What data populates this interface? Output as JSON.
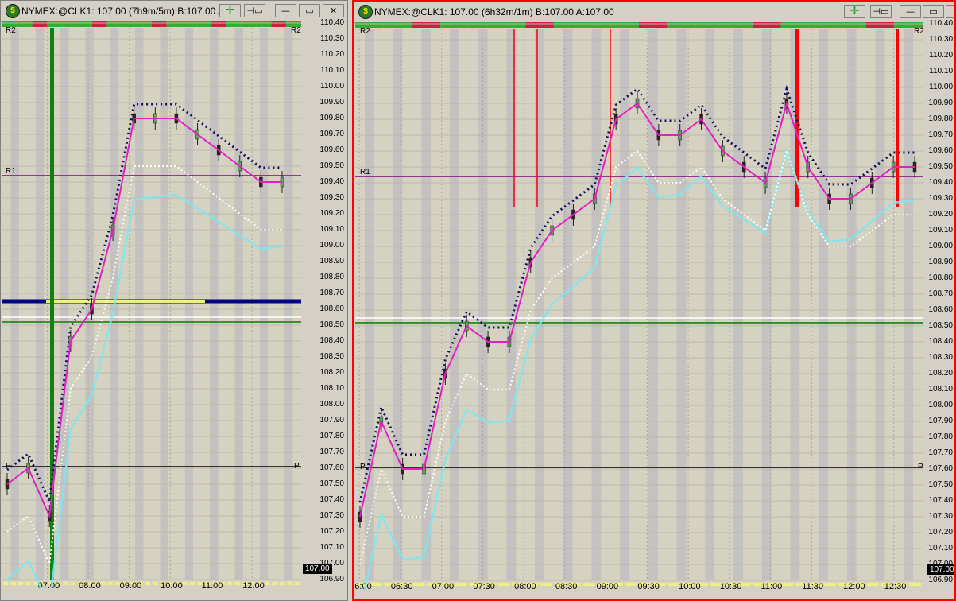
{
  "windows": [
    {
      "id": "left",
      "title": "NYMEX:@CLK1: 107.00 (7h9m/5m)   B:107.00 A:",
      "buttons": {
        "cursor": "✛",
        "pin": "⊣▭",
        "minimize": "—",
        "maximize": "▭",
        "close": "✕"
      },
      "price_labels": [
        "110.40",
        "110.30",
        "110.20",
        "110.10",
        "110.00",
        "109.90",
        "109.80",
        "109.70",
        "109.60",
        "109.50",
        "109.40",
        "109.30",
        "109.20",
        "109.10",
        "109.00",
        "108.90",
        "108.80",
        "108.70",
        "108.60",
        "108.50",
        "108.40",
        "108.30",
        "108.20",
        "108.10",
        "108.00",
        "107.90",
        "107.80",
        "107.70",
        "107.60",
        "107.50",
        "107.40",
        "107.30",
        "107.20",
        "107.10",
        "107.00",
        "106.90"
      ],
      "time_labels": [
        "07:00",
        "08:00",
        "09:00",
        "10:00",
        "11:00",
        "12:00"
      ],
      "last_price": "107.00",
      "level_labels": {
        "r2_left": "R2",
        "r2_right": "R2",
        "r1": "R1",
        "p_left": "P",
        "p_right": "P"
      }
    },
    {
      "id": "right",
      "title": "NYMEX:@CLK1: 107.00 (6h32m/1m)   B:107.00 A:107.00",
      "buttons": {
        "cursor": "✛",
        "pin": "⊣▭",
        "minimize": "—",
        "maximize": "▭",
        "close": "✕"
      },
      "price_labels": [
        "110.40",
        "110.30",
        "110.20",
        "110.10",
        "110.00",
        "109.90",
        "109.80",
        "109.70",
        "109.60",
        "109.50",
        "109.40",
        "109.30",
        "109.20",
        "109.10",
        "109.00",
        "108.90",
        "108.80",
        "108.70",
        "108.60",
        "108.50",
        "108.40",
        "108.30",
        "108.20",
        "108.10",
        "108.00",
        "107.90",
        "107.80",
        "107.70",
        "107.60",
        "107.50",
        "107.40",
        "107.30",
        "107.20",
        "107.10",
        "107.00",
        "106.90"
      ],
      "time_labels": [
        "06:00",
        "06:30",
        "07:00",
        "07:30",
        "08:00",
        "08:30",
        "09:00",
        "09:30",
        "10:00",
        "10:30",
        "11:00",
        "11:30",
        "12:00",
        "12:30"
      ],
      "last_price": "107.00",
      "level_labels": {
        "r2_left": "R2",
        "r2_right": "R2",
        "r1": "R1",
        "p_left": "P",
        "p_right": "P"
      }
    }
  ],
  "chart_data": [
    {
      "type": "line",
      "title": "NYMEX:@CLK1 5m",
      "ylim": [
        106.9,
        110.4
      ],
      "xlabel": "",
      "ylabel": "",
      "x": [
        "06:00",
        "06:30",
        "07:00",
        "07:30",
        "08:00",
        "08:30",
        "09:00",
        "09:30",
        "10:00",
        "10:30",
        "11:00",
        "11:30",
        "12:00",
        "12:20"
      ],
      "series": [
        {
          "name": "",
          "values": [
            107.5,
            107.6,
            107.3,
            108.4,
            108.6,
            109.1,
            109.8,
            109.8,
            109.8,
            109.7,
            109.6,
            109.5,
            109.4,
            109.4
          ]
        }
      ],
      "levels": {
        "R1": 109.44,
        "P": 107.61,
        "line_a": 108.65,
        "line_b": 108.52,
        "line_c": 108.55
      }
    },
    {
      "type": "line",
      "title": "NYMEX:@CLK1 1m",
      "ylim": [
        106.9,
        110.4
      ],
      "xlabel": "",
      "ylabel": "",
      "x": [
        "06:00",
        "06:15",
        "06:30",
        "06:45",
        "07:00",
        "07:15",
        "07:30",
        "07:45",
        "08:00",
        "08:15",
        "08:30",
        "08:45",
        "09:00",
        "09:15",
        "09:30",
        "09:45",
        "10:00",
        "10:15",
        "10:30",
        "10:45",
        "11:00",
        "11:15",
        "11:30",
        "11:45",
        "12:00",
        "12:15",
        "12:30"
      ],
      "series": [
        {
          "name": "",
          "values": [
            107.3,
            107.9,
            107.6,
            107.6,
            108.2,
            108.5,
            108.4,
            108.4,
            108.9,
            109.1,
            109.2,
            109.3,
            109.8,
            109.9,
            109.7,
            109.7,
            109.8,
            109.6,
            109.5,
            109.4,
            109.9,
            109.5,
            109.3,
            109.3,
            109.4,
            109.5,
            109.5
          ]
        }
      ],
      "levels": {
        "R1": 109.44,
        "P": 107.61,
        "line_a": 108.55,
        "line_b": 108.52
      }
    }
  ],
  "colors": {
    "r1": "#800080",
    "pivot": "#000000",
    "green_level": "#008000",
    "navy_level": "#000080",
    "cyan_band": "#7fe6f0",
    "red_marker": "#ff0000",
    "session_green": "#30b030",
    "session_red": "#cc2040"
  }
}
